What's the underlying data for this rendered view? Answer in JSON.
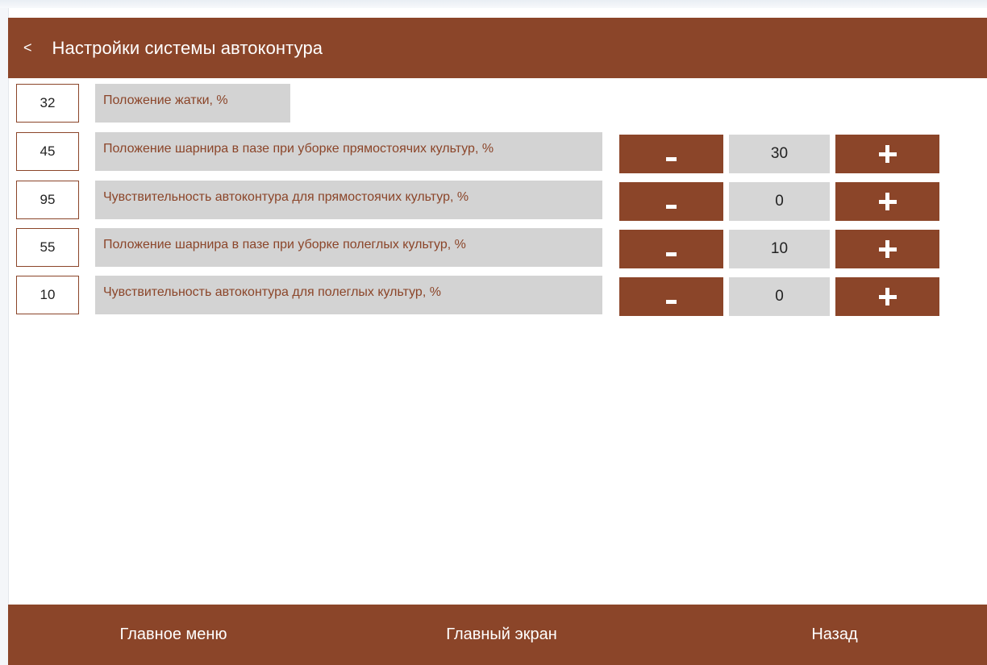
{
  "header": {
    "back_glyph": "<",
    "title": "Настройки системы автоконтура"
  },
  "rows": [
    {
      "value": "32",
      "label": "Положение жатки, %"
    },
    {
      "value": "45",
      "label": "Положение шарнира в пазе при уборке прямостоячих культур, %"
    },
    {
      "value": "95",
      "label": "Чувствительность автоконтура для прямостоячих культур, %"
    },
    {
      "value": "55",
      "label": "Положение шарнира в пазе при уборке полеглых культур, %"
    },
    {
      "value": "10",
      "label": "Чувствительность автоконтура для полеглых культур, %"
    }
  ],
  "steppers": [
    {
      "value": "30"
    },
    {
      "value": "0"
    },
    {
      "value": "10"
    },
    {
      "value": "0"
    }
  ],
  "footer": {
    "main_menu": "Главное меню",
    "main_screen": "Главный экран",
    "back": "Назад"
  },
  "colors": {
    "accent": "#8b4529",
    "label_background": "#d3d3d3",
    "text_on_accent": "#ffffff"
  },
  "icons": {
    "back": "chevron-left-icon",
    "decrement": "minus-icon",
    "increment": "plus-icon"
  }
}
